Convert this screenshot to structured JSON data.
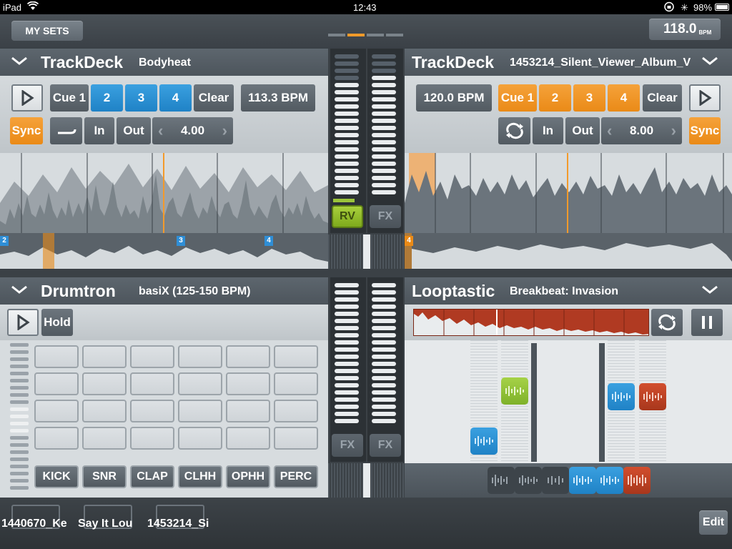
{
  "status_bar": {
    "device": "iPad",
    "time": "12:43",
    "battery": "98%"
  },
  "top_bar": {
    "my_sets_label": "MY SETS",
    "master_bpm": "118.0",
    "bpm_unit": "BPM"
  },
  "deck_left": {
    "title": "TrackDeck",
    "track": "Bodyheat",
    "cues": [
      "Cue 1",
      "2",
      "3",
      "4"
    ],
    "clear_label": "Clear",
    "bpm": "113.3 BPM",
    "sync_label": "Sync",
    "in_label": "In",
    "out_label": "Out",
    "loop_length": "4.00",
    "cue_markers": [
      "2",
      "3",
      "4"
    ]
  },
  "deck_right": {
    "title": "TrackDeck",
    "track": "1453214_Silent_Viewer_Album_V",
    "bpm": "120.0 BPM",
    "cues": [
      "Cue 1",
      "2",
      "3",
      "4"
    ],
    "clear_label": "Clear",
    "sync_label": "Sync",
    "in_label": "In",
    "out_label": "Out",
    "loop_length": "8.00",
    "cue_markers": [
      "4"
    ]
  },
  "mixer": {
    "rv_label": "RV",
    "fx_label": "FX"
  },
  "drumtron": {
    "title": "Drumtron",
    "kit": "basiX (125-150 BPM)",
    "hold_label": "Hold",
    "instruments": [
      "KICK",
      "SNR",
      "CLAP",
      "CLHH",
      "OPHH",
      "PERC"
    ]
  },
  "looptastic": {
    "title": "Looptastic",
    "loop_name": "Breakbeat: Invasion"
  },
  "sets": {
    "items": [
      "1440670_Ke",
      "Say It Lou",
      "1453214_Si"
    ],
    "edit_label": "Edit"
  },
  "colors": {
    "accent_orange": "#ea8a17",
    "accent_blue": "#1f82c6",
    "accent_green": "#7eaa1c",
    "loop_red": "#b03a22"
  }
}
